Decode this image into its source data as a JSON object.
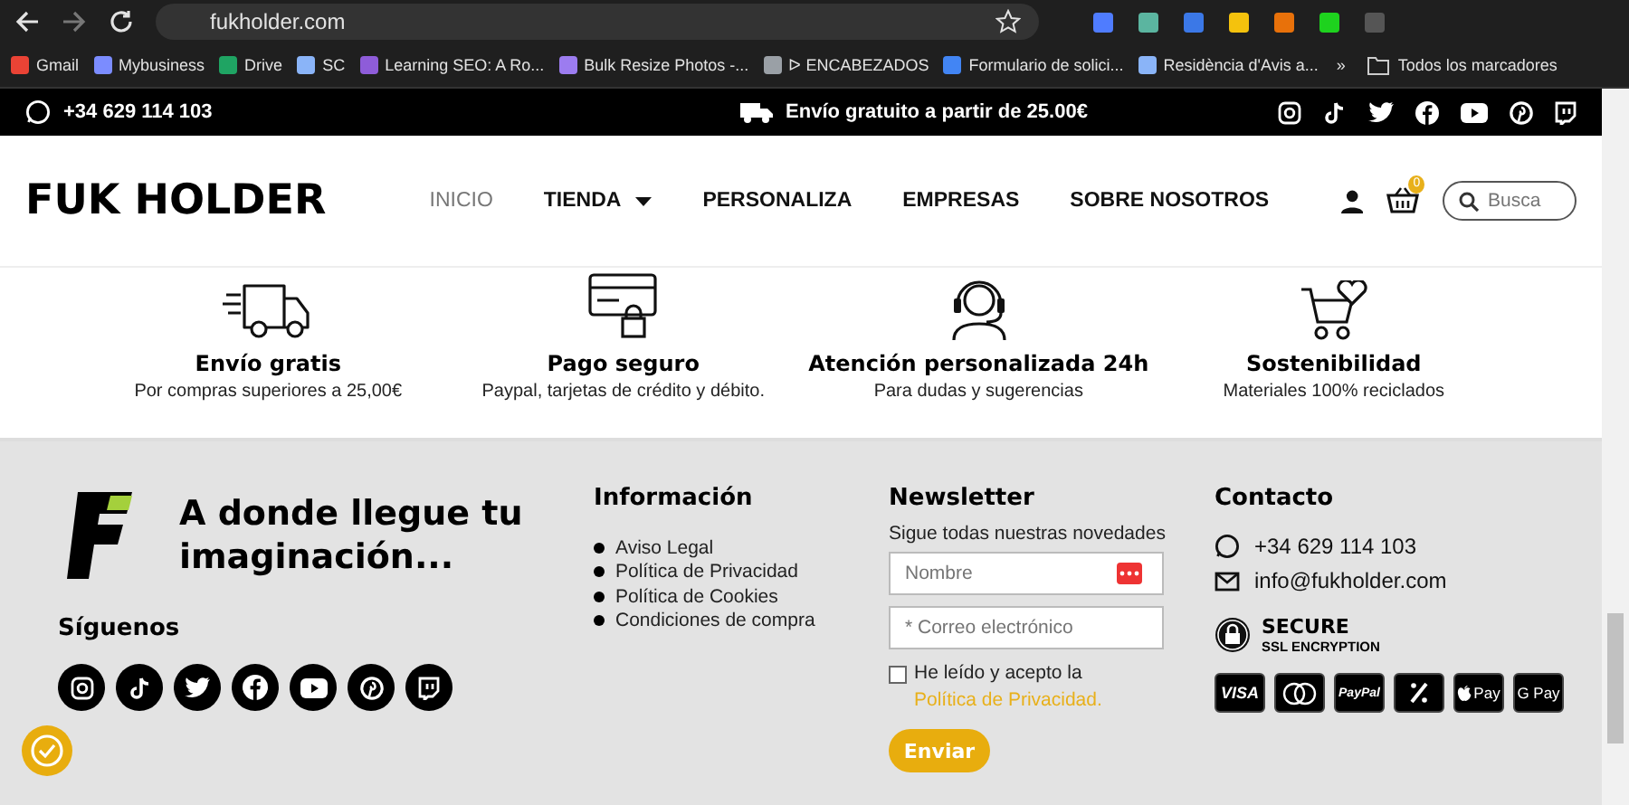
{
  "browser": {
    "url": "fukholder.com",
    "bookmarks": [
      {
        "label": "Gmail",
        "color": "#ea4335"
      },
      {
        "label": "Mybusiness",
        "color": "#7b8cff"
      },
      {
        "label": "Drive",
        "color": "#1fa463"
      },
      {
        "label": "SC",
        "color": "#8ab4f8"
      },
      {
        "label": "Learning SEO: A Ro...",
        "color": "#8e5cd9"
      },
      {
        "label": "Bulk Resize Photos -...",
        "color": "#9c7cf0"
      },
      {
        "label": "ᐅ ENCABEZADOS",
        "color": "#9aa0a6"
      },
      {
        "label": "Formulario de solici...",
        "color": "#4285f4"
      },
      {
        "label": "Residència d'Avis a...",
        "color": "#8ab4f8"
      }
    ],
    "more": "»",
    "all_bookmarks": "Todos los marcadores"
  },
  "topbar": {
    "phone": "+34 629 114 103",
    "shipping": "Envío gratuito a partir de 25.00€"
  },
  "nav": {
    "logo": "FUK HOLDER",
    "items": [
      {
        "label": "INICIO",
        "selected": true,
        "dropdown": false
      },
      {
        "label": "TIENDA",
        "selected": false,
        "dropdown": true
      },
      {
        "label": "PERSONALIZA",
        "selected": false,
        "dropdown": false
      },
      {
        "label": "EMPRESAS",
        "selected": false,
        "dropdown": false
      },
      {
        "label": "SOBRE NOSOTROS",
        "selected": false,
        "dropdown": false
      }
    ],
    "cart_count": "0",
    "search_placeholder": "Busca"
  },
  "features": [
    {
      "kind": "truck",
      "title": "Envío gratis",
      "subtitle": "Por compras superiores a 25,00€"
    },
    {
      "kind": "card",
      "title": "Pago seguro",
      "subtitle": "Paypal, tarjetas de crédito y débito."
    },
    {
      "kind": "headset",
      "title": "Atención personalizada 24h",
      "subtitle": "Para dudas y sugerencias"
    },
    {
      "kind": "cart",
      "title": "Sostenibilidad",
      "subtitle": "Materiales 100% reciclados"
    }
  ],
  "footer": {
    "tagline": "A donde llegue tu imaginación...",
    "follow_title": "Síguenos",
    "info": {
      "title": "Información",
      "links": [
        "Aviso Legal",
        "Política de Privacidad",
        "Política de Cookies",
        "Condiciones de compra"
      ]
    },
    "newsletter": {
      "title": "Newsletter",
      "subtitle": "Sigue todas nuestras novedades",
      "name_placeholder": "Nombre",
      "email_placeholder": "* Correo electrónico",
      "consent_text": "He leído y acepto la",
      "consent_link": "Política de Privacidad.",
      "checked": false,
      "button": "Enviar"
    },
    "contact": {
      "title": "Contacto",
      "phone": "+34 629 114 103",
      "email": "info@fukholder.com",
      "secure_title": "SECURE",
      "secure_subtitle": "SSL ENCRYPTION",
      "payments": [
        {
          "kind": "visa",
          "label": "VISA"
        },
        {
          "kind": "mastercard"
        },
        {
          "kind": "paypal",
          "label": "PayPal"
        },
        {
          "kind": "bizum"
        },
        {
          "kind": "applepay",
          "label": "Pay"
        },
        {
          "kind": "gpay",
          "label": "G Pay"
        }
      ]
    }
  }
}
